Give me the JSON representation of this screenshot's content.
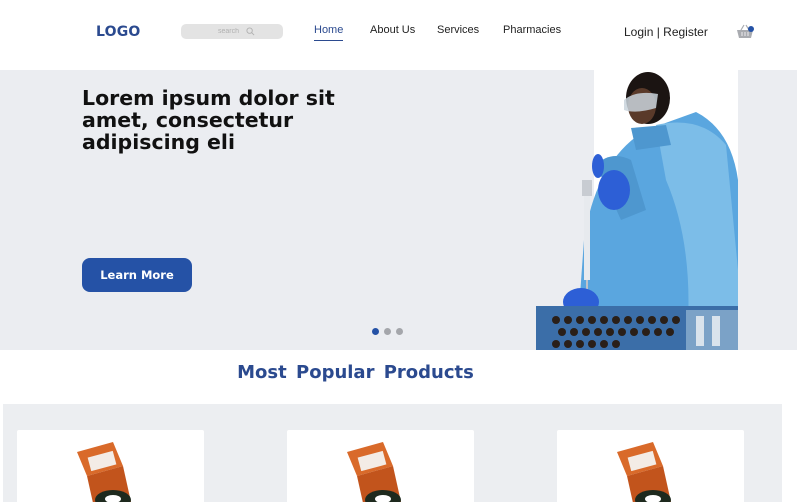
{
  "header": {
    "logo": "LOGO",
    "search_placeholder": "search",
    "nav": [
      {
        "label": "Home",
        "active": true
      },
      {
        "label": "About Us"
      },
      {
        "label": "Services"
      },
      {
        "label": "Pharmacies"
      }
    ],
    "auth_label": "Login | Register",
    "cart_icon": "basket-icon"
  },
  "hero": {
    "title": "Lorem ipsum dolor sit amet, consectetur adipiscing eli",
    "cta_label": "Learn More",
    "slides": 3,
    "active_slide": 1
  },
  "products": {
    "section_title": "Most  Popular Products",
    "items": [
      {
        "image": "pill-bottle-image"
      },
      {
        "image": "pill-bottle-image"
      },
      {
        "image": "pill-bottle-image"
      }
    ]
  },
  "colors": {
    "brand": "#2b4a8f",
    "button": "#2552a6",
    "hero_bg": "#ebedf1"
  }
}
